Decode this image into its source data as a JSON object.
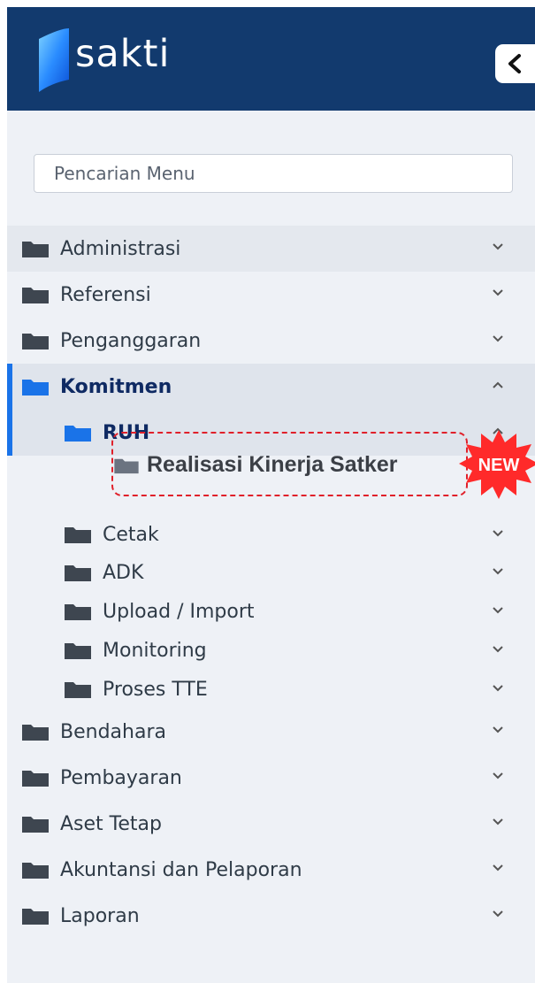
{
  "app": {
    "logo_text": "sakti"
  },
  "search": {
    "placeholder": "Pencarian Menu"
  },
  "menu": {
    "items": [
      {
        "label": "Administrasi"
      },
      {
        "label": "Referensi"
      },
      {
        "label": "Penganggaran"
      },
      {
        "label": "Komitmen"
      },
      {
        "label": "RUH"
      },
      {
        "label": "Realisasi Kinerja Satker"
      },
      {
        "label": "Cetak"
      },
      {
        "label": "ADK"
      },
      {
        "label": "Upload / Import"
      },
      {
        "label": "Monitoring"
      },
      {
        "label": "Proses TTE"
      },
      {
        "label": "Bendahara"
      },
      {
        "label": "Pembayaran"
      },
      {
        "label": "Aset Tetap"
      },
      {
        "label": "Akuntansi dan Pelaporan"
      },
      {
        "label": "Laporan"
      }
    ]
  },
  "badge": {
    "text": "NEW"
  },
  "colors": {
    "header_bg": "#123a6e",
    "accent": "#1a73e8",
    "highlight": "#e0202a",
    "badge": "#ff2a2a"
  }
}
